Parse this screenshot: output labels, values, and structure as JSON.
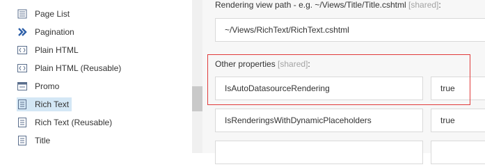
{
  "tree": {
    "items": [
      {
        "label": "Page List",
        "icon": "list-icon"
      },
      {
        "label": "Pagination",
        "icon": "double-chevron-right-icon"
      },
      {
        "label": "Plain HTML",
        "icon": "html-code-icon"
      },
      {
        "label": "Plain HTML (Reusable)",
        "icon": "html-code-icon"
      },
      {
        "label": "Promo",
        "icon": "promo-window-icon"
      },
      {
        "label": "Rich Text",
        "icon": "document-text-icon",
        "selected": true
      },
      {
        "label": "Rich Text (Reusable)",
        "icon": "document-text-icon"
      },
      {
        "label": "Title",
        "icon": "document-text-icon"
      }
    ]
  },
  "form": {
    "rendering_view_path": {
      "label": "Rendering view path - e.g. ~/Views/Title/Title.cshtml ",
      "shared": "[shared]",
      "suffix": ":",
      "value": "~/Views/RichText/RichText.cshtml"
    },
    "other_properties": {
      "label": "Other properties ",
      "shared": "[shared]",
      "suffix": ":",
      "rows": [
        {
          "key": "IsAutoDatasourceRendering",
          "value": "true"
        },
        {
          "key": "IsRenderingsWithDynamicPlaceholders",
          "value": "true"
        },
        {
          "key": "",
          "value": ""
        }
      ]
    }
  },
  "colors": {
    "selection": "#d4e7f5",
    "highlight_border": "#e03a3a",
    "shared_text": "#a3a3a3"
  }
}
